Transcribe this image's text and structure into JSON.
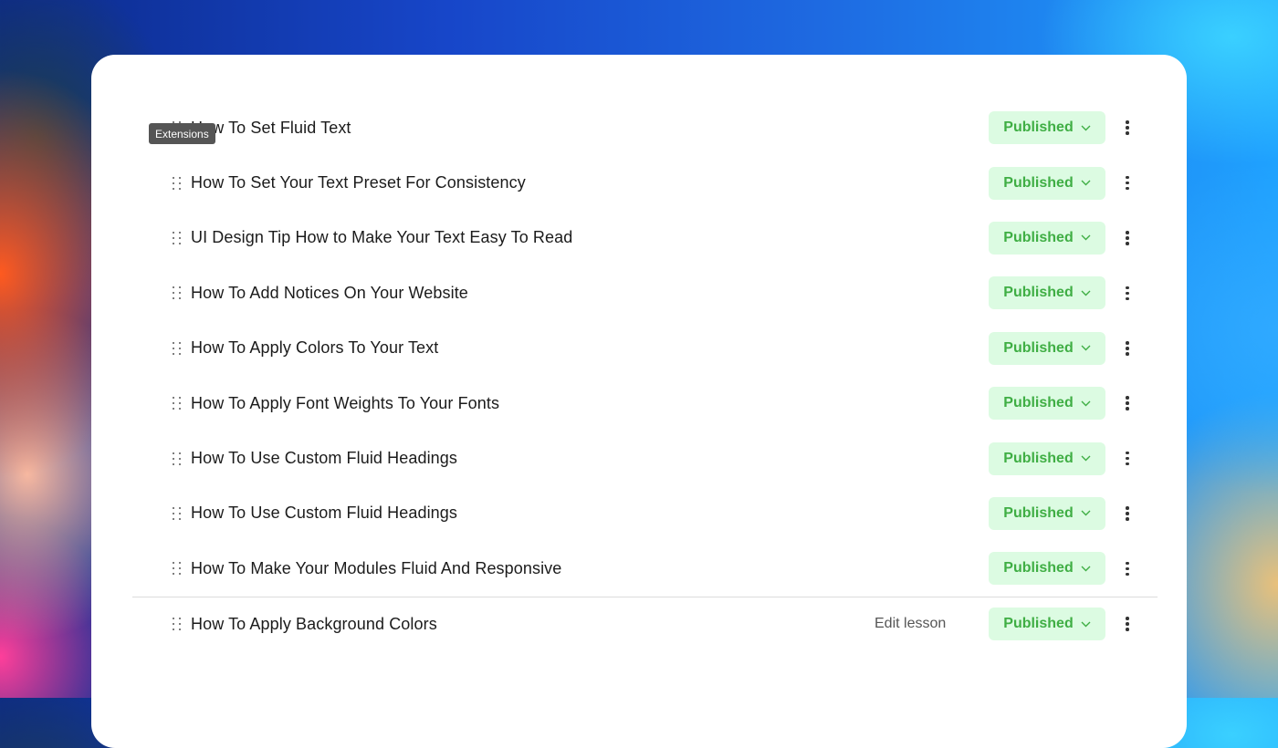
{
  "tooltip": {
    "text": "Extensions"
  },
  "lessons": [
    {
      "title": "How To Set Fluid Text",
      "status": "Published"
    },
    {
      "title": "How To Set Your Text Preset For Consistency",
      "status": "Published"
    },
    {
      "title": "UI Design Tip How to Make Your Text Easy To Read",
      "status": "Published"
    },
    {
      "title": "How To Add Notices On Your Website",
      "status": "Published"
    },
    {
      "title": "How To Apply Colors To Your Text",
      "status": "Published"
    },
    {
      "title": "How To Apply Font Weights To Your Fonts",
      "status": "Published"
    },
    {
      "title": "How To Use Custom Fluid Headings",
      "status": "Published"
    },
    {
      "title": "How To Use Custom Fluid Headings",
      "status": "Published"
    },
    {
      "title": "How To Make Your Modules Fluid And Responsive",
      "status": "Published"
    },
    {
      "title": "How To Apply Background Colors",
      "status": "Published",
      "edit_label": "Edit lesson"
    }
  ],
  "colors": {
    "status_bg": "#dcfbe2",
    "status_text": "#3fae44"
  },
  "icons": {
    "drag": "drag-handle-icon",
    "chevron": "chevron-down-icon",
    "more": "more-vertical-icon"
  }
}
